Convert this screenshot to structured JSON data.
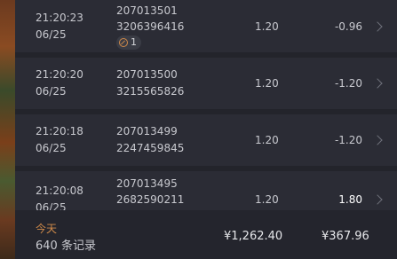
{
  "rows": [
    {
      "time": "21:20:23",
      "date": "06/25",
      "order_id": "207013501",
      "ref_id": "3206396416",
      "amount": "1.20",
      "pnl": "-0.96",
      "badge": "1",
      "pnl_positive": false
    },
    {
      "time": "21:20:20",
      "date": "06/25",
      "order_id": "207013500",
      "ref_id": "3215565826",
      "amount": "1.20",
      "pnl": "-1.20",
      "pnl_positive": false
    },
    {
      "time": "21:20:18",
      "date": "06/25",
      "order_id": "207013499",
      "ref_id": "2247459845",
      "amount": "1.20",
      "pnl": "-1.20",
      "pnl_positive": false
    },
    {
      "time": "21:20:08",
      "date": "06/25",
      "order_id": "207013495",
      "ref_id": "2682590211",
      "amount": "1.20",
      "pnl": "1.80",
      "pnl_positive": true
    }
  ],
  "footer": {
    "today_label": "今天",
    "record_count": "640 条记录",
    "total_amount": "¥1,262.40",
    "total_pnl": "¥367.96"
  },
  "colors": {
    "accent": "#d08a4a",
    "background": "#2a2b33",
    "text": "#c8c9cf"
  },
  "icons": {
    "row_chevron": "chevron-right-icon",
    "badge_icon": "link-icon"
  }
}
